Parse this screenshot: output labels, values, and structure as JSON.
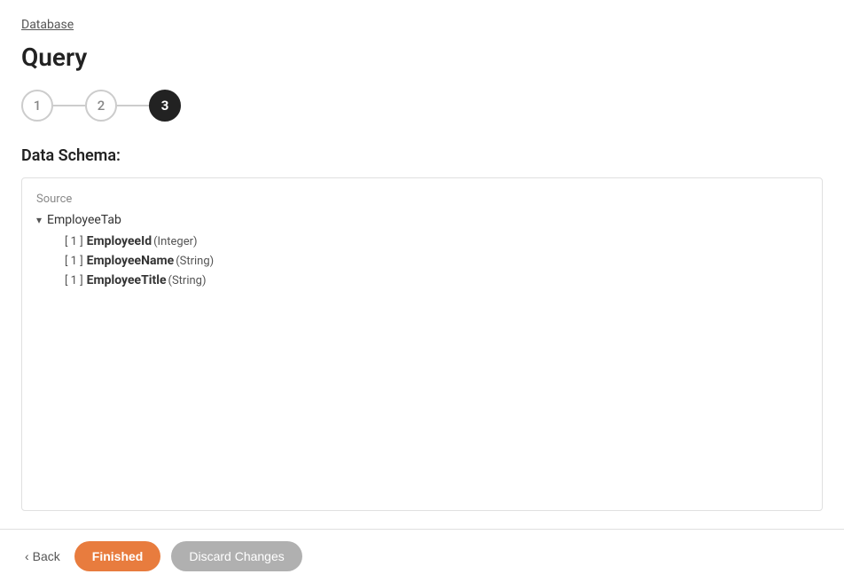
{
  "breadcrumb": {
    "label": "Database"
  },
  "page": {
    "title": "Query"
  },
  "steps": [
    {
      "number": "1",
      "active": false
    },
    {
      "number": "2",
      "active": false
    },
    {
      "number": "3",
      "active": true
    }
  ],
  "section": {
    "label": "Data Schema:"
  },
  "source_label": "Source",
  "schema": {
    "root_name": "EmployeeTab",
    "fields": [
      {
        "bracket": "[ 1 ]",
        "name": "EmployeeId",
        "type": "(Integer)"
      },
      {
        "bracket": "[ 1 ]",
        "name": "EmployeeName",
        "type": "(String)"
      },
      {
        "bracket": "[ 1 ]",
        "name": "EmployeeTitle",
        "type": "(String)"
      }
    ]
  },
  "footer": {
    "back_label": "Back",
    "finished_label": "Finished",
    "discard_label": "Discard Changes"
  }
}
